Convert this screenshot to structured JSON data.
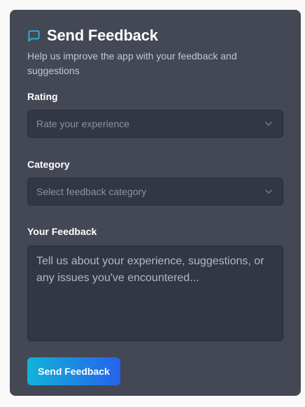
{
  "header": {
    "icon": "message-square-icon",
    "title": "Send Feedback",
    "subtitle": "Help us improve the app with your feedback and suggestions"
  },
  "form": {
    "rating": {
      "label": "Rating",
      "placeholder": "Rate your experience"
    },
    "category": {
      "label": "Category",
      "placeholder": "Select feedback category"
    },
    "feedback": {
      "label": "Your Feedback",
      "placeholder": "Tell us about your experience, suggestions, or any issues you've encountered..."
    },
    "submit_label": "Send Feedback"
  },
  "colors": {
    "card_background": "#444855",
    "input_background": "#333744",
    "icon_accent": "#22c5e8",
    "button_gradient_start": "#12b2d8",
    "button_gradient_end": "#2563eb"
  }
}
